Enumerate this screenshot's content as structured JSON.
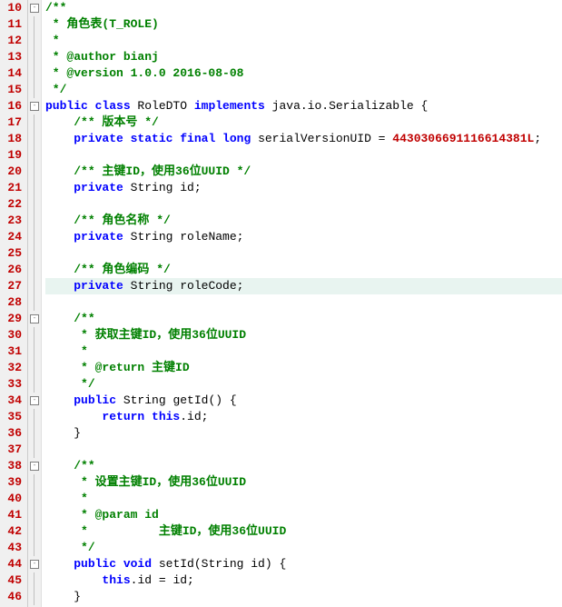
{
  "lines": [
    {
      "n": "10",
      "fold": "box",
      "code": [
        {
          "c": "c-doc",
          "t": "/**"
        }
      ]
    },
    {
      "n": "11",
      "fold": "line",
      "code": [
        {
          "c": "c-doc",
          "t": " * 角色表(T_ROLE)"
        }
      ]
    },
    {
      "n": "12",
      "fold": "line",
      "code": [
        {
          "c": "c-doc",
          "t": " * "
        }
      ]
    },
    {
      "n": "13",
      "fold": "line",
      "code": [
        {
          "c": "c-doc",
          "t": " * @author bianj"
        }
      ]
    },
    {
      "n": "14",
      "fold": "line",
      "code": [
        {
          "c": "c-doc",
          "t": " * @version 1.0.0 2016-08-08"
        }
      ]
    },
    {
      "n": "15",
      "fold": "line",
      "code": [
        {
          "c": "c-doc",
          "t": " */"
        }
      ]
    },
    {
      "n": "16",
      "fold": "box",
      "code": [
        {
          "c": "c-kw",
          "t": "public class "
        },
        {
          "c": "c-type",
          "t": "RoleDTO "
        },
        {
          "c": "c-kw",
          "t": "implements "
        },
        {
          "c": "c-type",
          "t": "java.io.Serializable "
        },
        {
          "c": "c-plain",
          "t": "{"
        }
      ]
    },
    {
      "n": "17",
      "fold": "line",
      "indent": 1,
      "code": [
        {
          "c": "c-doc",
          "t": "/** 版本号 */"
        }
      ]
    },
    {
      "n": "18",
      "fold": "line",
      "indent": 1,
      "code": [
        {
          "c": "c-kw",
          "t": "private static final long "
        },
        {
          "c": "c-id",
          "t": "serialVersionUID = "
        },
        {
          "c": "c-num",
          "t": "4430306691116614381L"
        },
        {
          "c": "c-plain",
          "t": ";"
        }
      ]
    },
    {
      "n": "19",
      "fold": "line",
      "indent": 1,
      "code": []
    },
    {
      "n": "20",
      "fold": "line",
      "indent": 1,
      "code": [
        {
          "c": "c-doc",
          "t": "/** 主键ID，使用36位UUID */"
        }
      ]
    },
    {
      "n": "21",
      "fold": "line",
      "indent": 1,
      "code": [
        {
          "c": "c-kw",
          "t": "private "
        },
        {
          "c": "c-type",
          "t": "String "
        },
        {
          "c": "c-id",
          "t": "id;"
        }
      ]
    },
    {
      "n": "22",
      "fold": "line",
      "indent": 1,
      "code": []
    },
    {
      "n": "23",
      "fold": "line",
      "indent": 1,
      "code": [
        {
          "c": "c-doc",
          "t": "/** 角色名称 */"
        }
      ]
    },
    {
      "n": "24",
      "fold": "line",
      "indent": 1,
      "code": [
        {
          "c": "c-kw",
          "t": "private "
        },
        {
          "c": "c-type",
          "t": "String "
        },
        {
          "c": "c-id",
          "t": "roleName;"
        }
      ]
    },
    {
      "n": "25",
      "fold": "line",
      "indent": 1,
      "code": []
    },
    {
      "n": "26",
      "fold": "line",
      "indent": 1,
      "code": [
        {
          "c": "c-doc",
          "t": "/** 角色编码 */"
        }
      ]
    },
    {
      "n": "27",
      "fold": "line",
      "indent": 1,
      "hl": true,
      "code": [
        {
          "c": "c-kw",
          "t": "private "
        },
        {
          "c": "c-type",
          "t": "String "
        },
        {
          "c": "c-id",
          "t": "roleCode;"
        }
      ]
    },
    {
      "n": "28",
      "fold": "line",
      "indent": 1,
      "code": []
    },
    {
      "n": "29",
      "fold": "box",
      "indent": 1,
      "code": [
        {
          "c": "c-doc",
          "t": "/**"
        }
      ]
    },
    {
      "n": "30",
      "fold": "line",
      "indent": 1,
      "code": [
        {
          "c": "c-doc",
          "t": " * 获取主键ID，使用36位UUID"
        }
      ]
    },
    {
      "n": "31",
      "fold": "line",
      "indent": 1,
      "code": [
        {
          "c": "c-doc",
          "t": " * "
        }
      ]
    },
    {
      "n": "32",
      "fold": "line",
      "indent": 1,
      "code": [
        {
          "c": "c-doc",
          "t": " * @return 主键ID"
        }
      ]
    },
    {
      "n": "33",
      "fold": "line",
      "indent": 1,
      "code": [
        {
          "c": "c-doc",
          "t": " */"
        }
      ]
    },
    {
      "n": "34",
      "fold": "box",
      "indent": 1,
      "code": [
        {
          "c": "c-kw",
          "t": "public "
        },
        {
          "c": "c-type",
          "t": "String "
        },
        {
          "c": "c-id",
          "t": "getId() {"
        }
      ]
    },
    {
      "n": "35",
      "fold": "line",
      "indent": 2,
      "code": [
        {
          "c": "c-kw",
          "t": "return this"
        },
        {
          "c": "c-plain",
          "t": ".id;"
        }
      ]
    },
    {
      "n": "36",
      "fold": "line",
      "indent": 1,
      "code": [
        {
          "c": "c-plain",
          "t": "}"
        }
      ]
    },
    {
      "n": "37",
      "fold": "line",
      "indent": 1,
      "code": []
    },
    {
      "n": "38",
      "fold": "box",
      "indent": 1,
      "code": [
        {
          "c": "c-doc",
          "t": "/**"
        }
      ]
    },
    {
      "n": "39",
      "fold": "line",
      "indent": 1,
      "code": [
        {
          "c": "c-doc",
          "t": " * 设置主键ID，使用36位UUID"
        }
      ]
    },
    {
      "n": "40",
      "fold": "line",
      "indent": 1,
      "code": [
        {
          "c": "c-doc",
          "t": " * "
        }
      ]
    },
    {
      "n": "41",
      "fold": "line",
      "indent": 1,
      "code": [
        {
          "c": "c-doc",
          "t": " * @param id"
        }
      ]
    },
    {
      "n": "42",
      "fold": "line",
      "indent": 1,
      "code": [
        {
          "c": "c-doc",
          "t": " *          主键ID，使用36位UUID"
        }
      ]
    },
    {
      "n": "43",
      "fold": "line",
      "indent": 1,
      "code": [
        {
          "c": "c-doc",
          "t": " */"
        }
      ]
    },
    {
      "n": "44",
      "fold": "box",
      "indent": 1,
      "code": [
        {
          "c": "c-kw",
          "t": "public void "
        },
        {
          "c": "c-id",
          "t": "setId(String id) {"
        }
      ]
    },
    {
      "n": "45",
      "fold": "line",
      "indent": 2,
      "code": [
        {
          "c": "c-kw",
          "t": "this"
        },
        {
          "c": "c-plain",
          "t": ".id = id;"
        }
      ]
    },
    {
      "n": "46",
      "fold": "line",
      "indent": 1,
      "code": [
        {
          "c": "c-plain",
          "t": "}"
        }
      ]
    }
  ]
}
